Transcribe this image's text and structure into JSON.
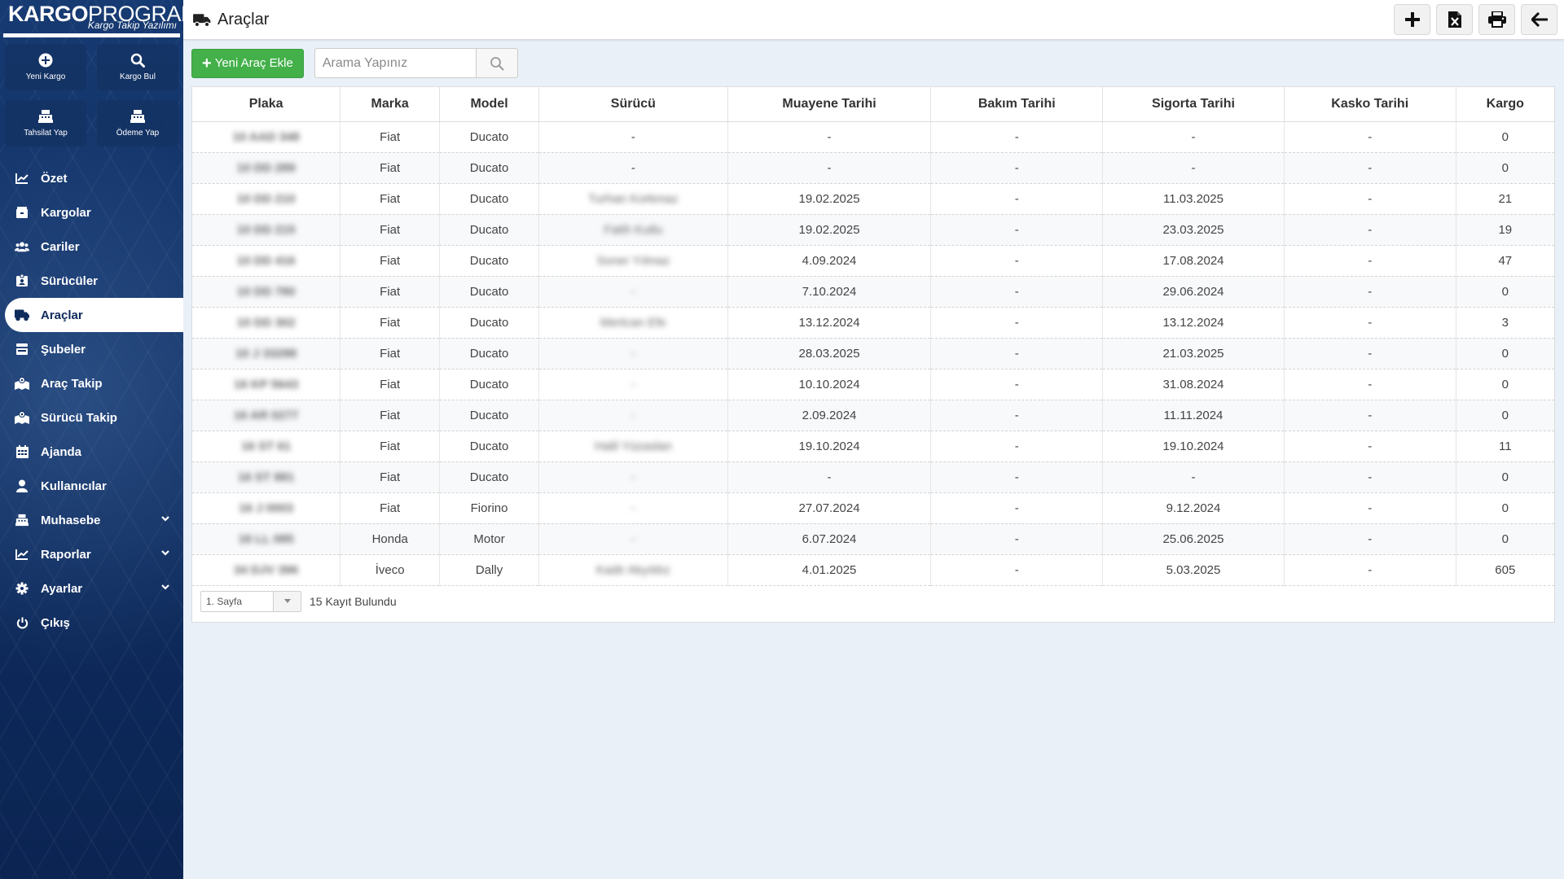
{
  "logo": {
    "bold": "KARGO",
    "light": "PROGRAMI",
    "sub": "Kargo Takip Yazılımı"
  },
  "quick_actions": [
    {
      "label": "Yeni Kargo",
      "icon": "plus-circle-icon"
    },
    {
      "label": "Kargo Bul",
      "icon": "search-icon"
    },
    {
      "label": "Tahsilat Yap",
      "icon": "cash-register-icon"
    },
    {
      "label": "Ödeme Yap",
      "icon": "cash-register-icon"
    }
  ],
  "menu": [
    {
      "label": "Özet",
      "icon": "chart-line-icon"
    },
    {
      "label": "Kargolar",
      "icon": "box-icon"
    },
    {
      "label": "Cariler",
      "icon": "users-icon"
    },
    {
      "label": "Sürücüler",
      "icon": "id-card-icon"
    },
    {
      "label": "Araçlar",
      "icon": "truck-icon",
      "active": true
    },
    {
      "label": "Şubeler",
      "icon": "store-icon"
    },
    {
      "label": "Araç Takip",
      "icon": "map-marked-icon"
    },
    {
      "label": "Sürücü Takip",
      "icon": "map-marked-icon"
    },
    {
      "label": "Ajanda",
      "icon": "calendar-icon"
    },
    {
      "label": "Kullanıcılar",
      "icon": "user-icon"
    },
    {
      "label": "Muhasebe",
      "icon": "cash-register-icon",
      "dropdown": true
    },
    {
      "label": "Raporlar",
      "icon": "chart-line-icon",
      "dropdown": true
    },
    {
      "label": "Ayarlar",
      "icon": "gear-icon",
      "dropdown": true
    },
    {
      "label": "Çıkış",
      "icon": "power-icon"
    }
  ],
  "header": {
    "title": "Araçlar",
    "icon": "truck-icon",
    "buttons": [
      "plus-icon",
      "excel-icon",
      "print-icon",
      "back-arrow-icon"
    ]
  },
  "toolbar": {
    "add_label": "Yeni Araç Ekle",
    "search_placeholder": "Arama Yapınız"
  },
  "table": {
    "columns": [
      "Plaka",
      "Marka",
      "Model",
      "Sürücü",
      "Muayene Tarihi",
      "Bakım Tarihi",
      "Sigorta Tarihi",
      "Kasko Tarihi",
      "Kargo"
    ],
    "rows": [
      [
        "10 AAD 348",
        "Fiat",
        "Ducato",
        "-",
        "-",
        "-",
        "-",
        "-",
        "0"
      ],
      [
        "10 DD 289",
        "Fiat",
        "Ducato",
        "-",
        "-",
        "-",
        "-",
        "-",
        "0"
      ],
      [
        "10 DD 210",
        "Fiat",
        "Ducato",
        "Turhan Korkmaz",
        "19.02.2025",
        "-",
        "11.03.2025",
        "-",
        "21"
      ],
      [
        "10 DD 215",
        "Fiat",
        "Ducato",
        "Fatih Kutlu",
        "19.02.2025",
        "-",
        "23.03.2025",
        "-",
        "19"
      ],
      [
        "10 DD 416",
        "Fiat",
        "Ducato",
        "Soner Yılmaz",
        "4.09.2024",
        "-",
        "17.08.2024",
        "-",
        "47"
      ],
      [
        "10 DD 780",
        "Fiat",
        "Ducato",
        "-",
        "7.10.2024",
        "-",
        "29.06.2024",
        "-",
        "0"
      ],
      [
        "10 DD 302",
        "Fiat",
        "Ducato",
        "Mertcan Efe",
        "13.12.2024",
        "-",
        "13.12.2024",
        "-",
        "3"
      ],
      [
        "10 J 33288",
        "Fiat",
        "Ducato",
        "-",
        "28.03.2025",
        "-",
        "21.03.2025",
        "-",
        "0"
      ],
      [
        "16 KP 5643",
        "Fiat",
        "Ducato",
        "-",
        "10.10.2024",
        "-",
        "31.08.2024",
        "-",
        "0"
      ],
      [
        "16 AR 0277",
        "Fiat",
        "Ducato",
        "-",
        "2.09.2024",
        "-",
        "11.11.2024",
        "-",
        "0"
      ],
      [
        "16 ST 61",
        "Fiat",
        "Ducato",
        "Halil Yüzaslan",
        "19.10.2024",
        "-",
        "19.10.2024",
        "-",
        "11"
      ],
      [
        "16 ST 881",
        "Fiat",
        "Ducato",
        "-",
        "-",
        "-",
        "-",
        "-",
        "0"
      ],
      [
        "16 J 0003",
        "Fiat",
        "Fiorino",
        "-",
        "27.07.2024",
        "-",
        "9.12.2024",
        "-",
        "0"
      ],
      [
        "16 LL 085",
        "Honda",
        "Motor",
        "-",
        "6.07.2024",
        "-",
        "25.06.2025",
        "-",
        "0"
      ],
      [
        "34 DJV 396",
        "İveco",
        "Dally",
        "Kadir Akyıldız",
        "4.01.2025",
        "-",
        "5.03.2025",
        "-",
        "605"
      ]
    ]
  },
  "pager": {
    "page_label": "1. Sayfa",
    "count_label": "15 Kayıt Bulundu"
  },
  "colors": {
    "sidebar": "#102f63",
    "accent_green": "#43b04a",
    "background": "#eaf0f8"
  }
}
